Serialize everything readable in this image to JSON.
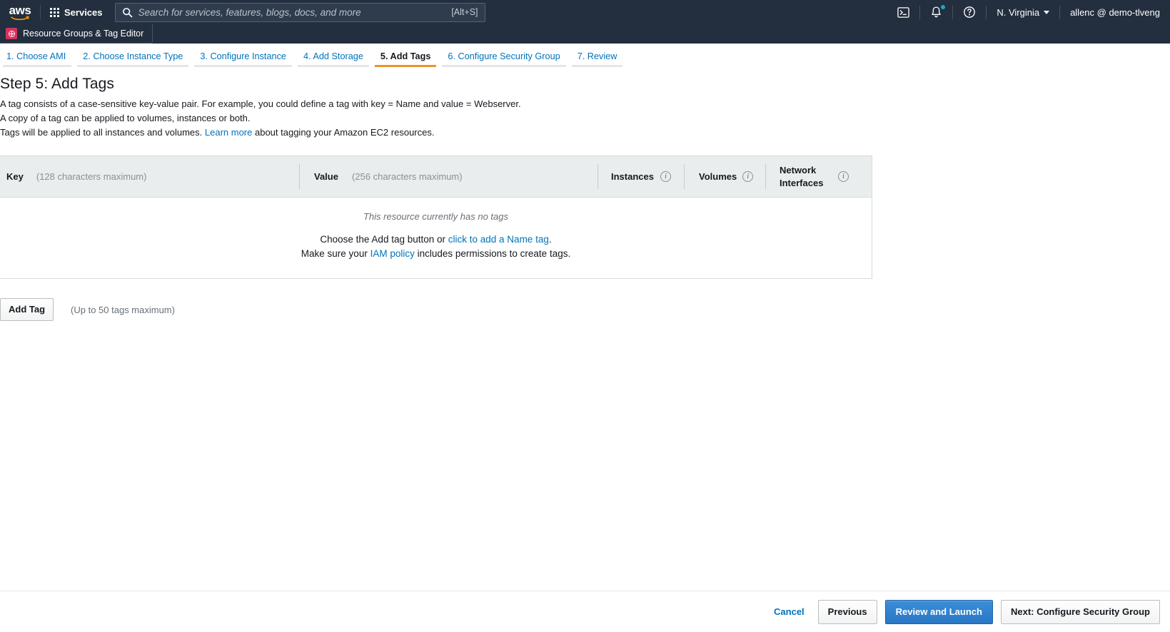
{
  "topnav": {
    "logo_text": "aws",
    "services_label": "Services",
    "search_placeholder": "Search for services, features, blogs, docs, and more",
    "search_value": "",
    "search_shortcut": "[Alt+S]",
    "cloudshell_icon": "terminal-icon",
    "notifications_icon": "bell-icon",
    "help_icon": "question-circle-icon",
    "region_label": "N. Virginia",
    "account_label": "allenc @ demo-tlveng"
  },
  "subnav": {
    "favorite_label": "Resource Groups & Tag Editor"
  },
  "wizard": {
    "steps": [
      {
        "label": "1. Choose AMI",
        "active": false
      },
      {
        "label": "2. Choose Instance Type",
        "active": false
      },
      {
        "label": "3. Configure Instance",
        "active": false
      },
      {
        "label": "4. Add Storage",
        "active": false
      },
      {
        "label": "5. Add Tags",
        "active": true
      },
      {
        "label": "6. Configure Security Group",
        "active": false
      },
      {
        "label": "7. Review",
        "active": false
      }
    ]
  },
  "page": {
    "title": "Step 5: Add Tags",
    "desc_line1": "A tag consists of a case-sensitive key-value pair. For example, you could define a tag with key = Name and value = Webserver.",
    "desc_line2": "A copy of a tag can be applied to volumes, instances or both.",
    "desc_line3_pre": "Tags will be applied to all instances and volumes. ",
    "desc_line3_link": "Learn more",
    "desc_line3_post": " about tagging your Amazon EC2 resources."
  },
  "tag_table": {
    "columns": [
      {
        "name": "Key",
        "hint": "(128 characters maximum)",
        "info": false
      },
      {
        "name": "Value",
        "hint": "(256 characters maximum)",
        "info": false
      },
      {
        "name": "Instances",
        "hint": "",
        "info": true
      },
      {
        "name": "Volumes",
        "hint": "",
        "info": true
      },
      {
        "name": "Network Interfaces",
        "hint": "",
        "info": true
      }
    ],
    "empty_italic": "This resource currently has no tags",
    "empty_line1_pre": "Choose the Add tag button or ",
    "empty_line1_link": "click to add a Name tag",
    "empty_line1_post": ".",
    "empty_line2_pre": "Make sure your ",
    "empty_line2_link": "IAM policy",
    "empty_line2_post": " includes permissions to create tags."
  },
  "actions": {
    "add_tag_label": "Add Tag",
    "add_tag_hint": "(Up to 50 tags maximum)"
  },
  "footer": {
    "cancel_label": "Cancel",
    "previous_label": "Previous",
    "review_label": "Review and Launch",
    "next_label": "Next: Configure Security Group"
  },
  "colors": {
    "nav_bg": "#232f3e",
    "link_blue": "#0073bb",
    "active_orange": "#ec912d",
    "primary_blue": "#2a76c6",
    "rg_pink": "#d8315e"
  }
}
